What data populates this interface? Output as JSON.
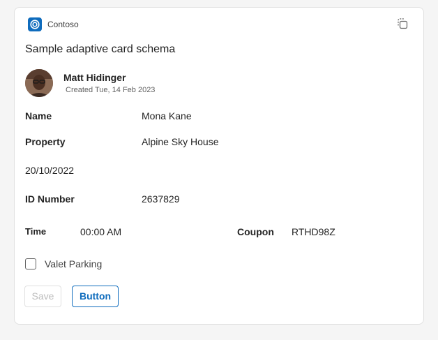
{
  "header": {
    "app_name": "Contoso",
    "app_icon": "contoso-logo-icon",
    "copy_icon": "copy-icon"
  },
  "card": {
    "title": "Sample adaptive card schema",
    "author": {
      "name": "Matt Hidinger",
      "created": "Created Tue, 14 Feb 2023"
    },
    "facts": [
      {
        "label": "Name",
        "value": "Mona Kane"
      },
      {
        "label": "Property",
        "value": "Alpine Sky House"
      }
    ],
    "date": "20/10/2022",
    "id": {
      "label": "ID Number",
      "value": "2637829"
    },
    "time": {
      "label": "Time",
      "value": "00:00 AM"
    },
    "coupon": {
      "label": "Coupon",
      "value": "RTHD98Z"
    },
    "checkbox": {
      "label": "Valet Parking",
      "checked": false
    },
    "actions": {
      "save_label": "Save",
      "button_label": "Button"
    }
  },
  "colors": {
    "accent": "#0f6cbd",
    "background": "#f5f5f5",
    "card": "#ffffff"
  }
}
